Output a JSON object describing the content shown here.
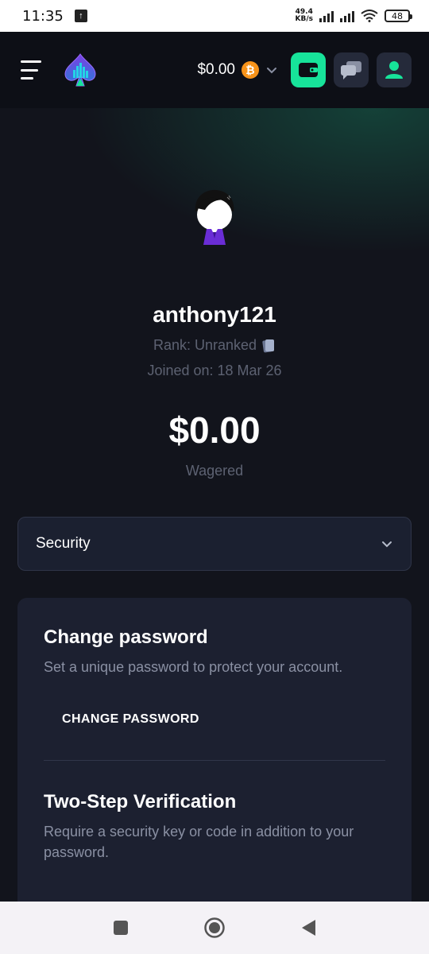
{
  "status_bar": {
    "time": "11:35",
    "net_speed_value": "49.4",
    "net_speed_unit": "KB/s",
    "battery": "48"
  },
  "header": {
    "balance": "$0.00",
    "currency_icon": "bitcoin-icon",
    "brand_green": "#17e39a"
  },
  "profile": {
    "username": "anthony121",
    "rank": "Rank: Unranked",
    "joined": "Joined on: 18 Mar 26",
    "wagered_amount": "$0.00",
    "wagered_label": "Wagered"
  },
  "section_select": {
    "selected": "Security"
  },
  "security": {
    "change_password_title": "Change password",
    "change_password_desc": "Set a unique password to protect your account.",
    "change_password_button": "CHANGE PASSWORD",
    "two_step_title": "Two-Step Verification",
    "two_step_desc": "Require a security key or code in addition to your password."
  }
}
